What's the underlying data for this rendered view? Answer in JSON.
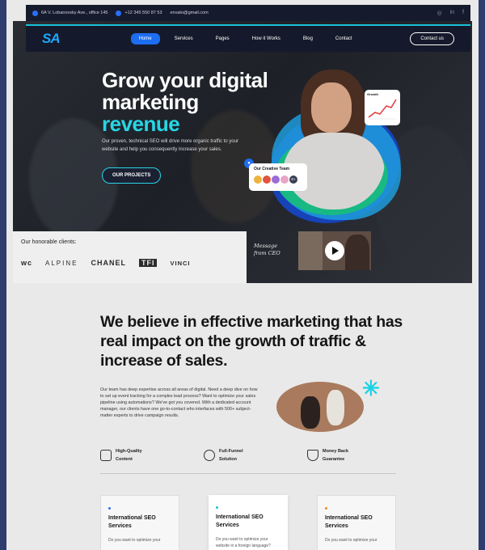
{
  "topbar": {
    "address": "6A V. Lobanovsky Ave., office 145",
    "phone": "+12 345 550 87 53",
    "email": "envato@gmail.com",
    "social": [
      "◎",
      "in",
      "f"
    ]
  },
  "nav": {
    "logo": "SA",
    "items": [
      "Home",
      "Services",
      "Pages",
      "How it Works",
      "Blog",
      "Contact"
    ],
    "cta": "Contact us"
  },
  "hero": {
    "title_1": "Grow your digital",
    "title_2": "marketing",
    "title_accent": "revenue",
    "subtitle": "Our proven, technical SEO will drive more organic traffic to your website and help you consequently increase your sales.",
    "button": "OUR PROJECTS",
    "growth_label": "Growth",
    "team_label": "Our Creative Team",
    "team_more": "8+"
  },
  "clients": {
    "title": "Our honorable clients:",
    "brands": [
      "wc",
      "ALPINE",
      "CHANEL",
      "TFI",
      "VINCI"
    ]
  },
  "video": {
    "message": "Message from CEO"
  },
  "about": {
    "headline": "We believe in effective marketing that has real impact on the growth of traffic & increase of sales.",
    "paragraph": "Our team has deep expertise across all areas of digital. Need a deep dive on how to set up event tracking for a complex lead process? Want to optimize your sales pipeline using automations? We've got you covered. With a dedicated account manager, our clients have one go-to-contact who interfaces with 500+ subject-matter experts to drive campaign results.",
    "features": [
      {
        "line1": "High-Quality",
        "line2": "Content"
      },
      {
        "line1": "Full-Funnel",
        "line2": "Solution"
      },
      {
        "line1": "Money Back",
        "line2": "Guarantee"
      }
    ]
  },
  "cards": [
    {
      "title": "International SEO Services",
      "text": "Do you want to optimize your",
      "dot": "#2b6ef5"
    },
    {
      "title": "International SEO Services",
      "text": "Do you want to optimize your website in a foreign language?",
      "dot": "#18c2d6"
    },
    {
      "title": "International SEO Services",
      "text": "Do you want to optimize your",
      "dot": "#f08a24"
    }
  ],
  "colors": {
    "accent": "#27d6e6",
    "primary": "#1d6df0",
    "dark": "#141a2b"
  }
}
